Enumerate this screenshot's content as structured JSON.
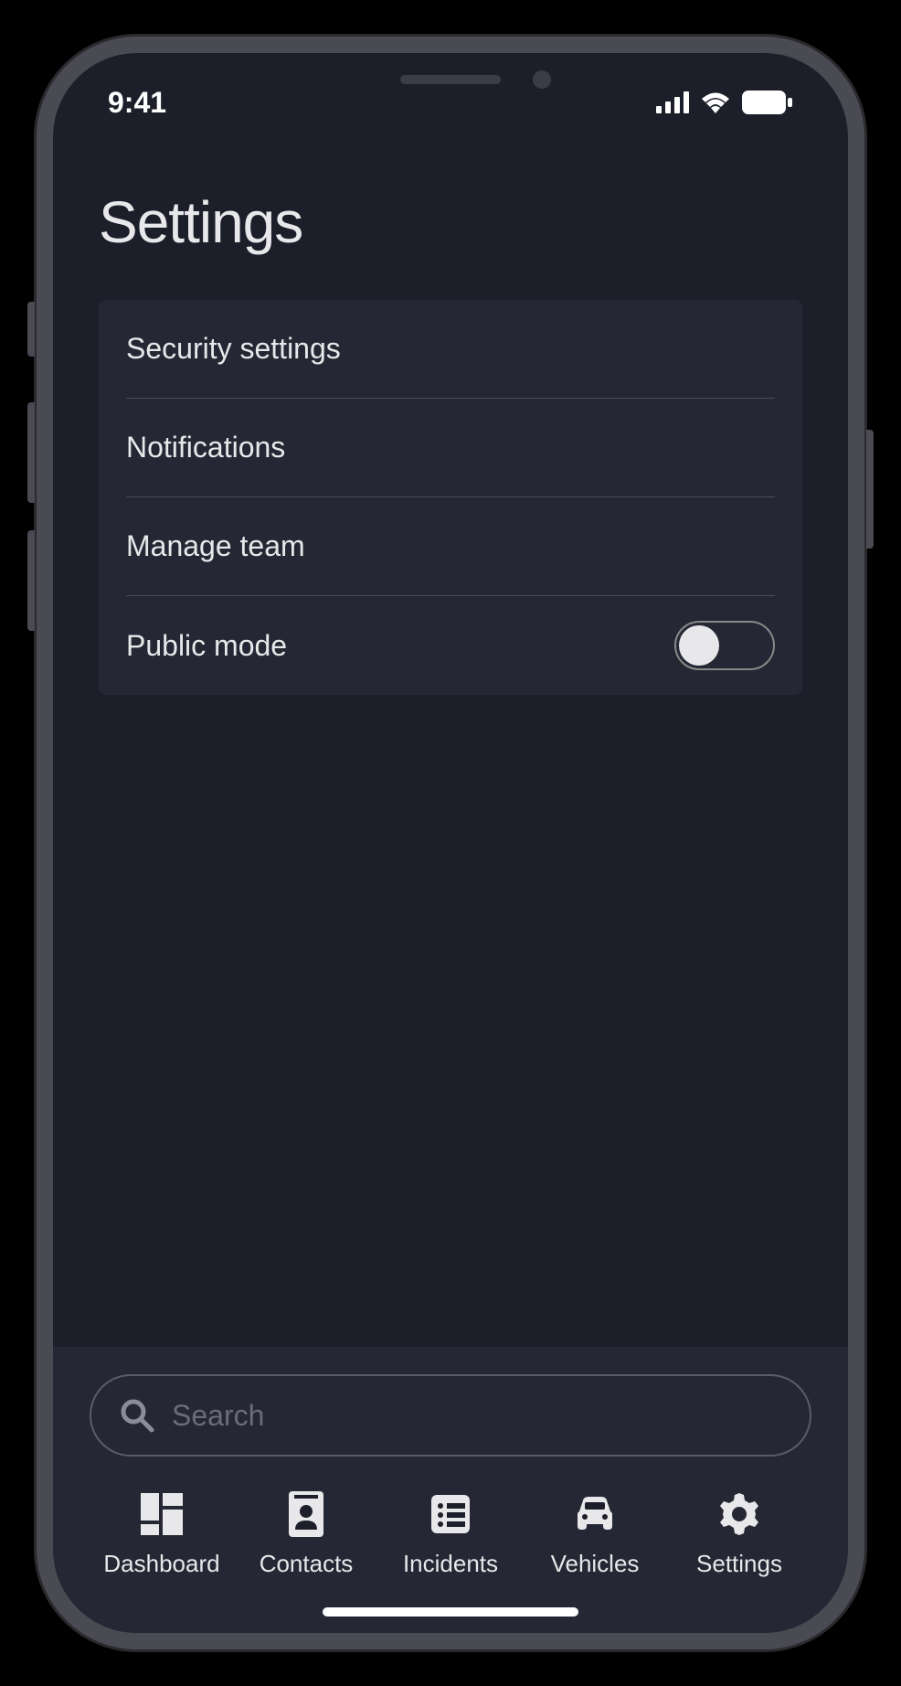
{
  "status_bar": {
    "time": "9:41"
  },
  "page": {
    "title": "Settings"
  },
  "settings": {
    "items": [
      {
        "label": "Security settings"
      },
      {
        "label": "Notifications"
      },
      {
        "label": "Manage team"
      },
      {
        "label": "Public mode"
      }
    ]
  },
  "search": {
    "placeholder": "Search"
  },
  "tabs": [
    {
      "label": "Dashboard"
    },
    {
      "label": "Contacts"
    },
    {
      "label": "Incidents"
    },
    {
      "label": "Vehicles"
    },
    {
      "label": "Settings"
    }
  ]
}
